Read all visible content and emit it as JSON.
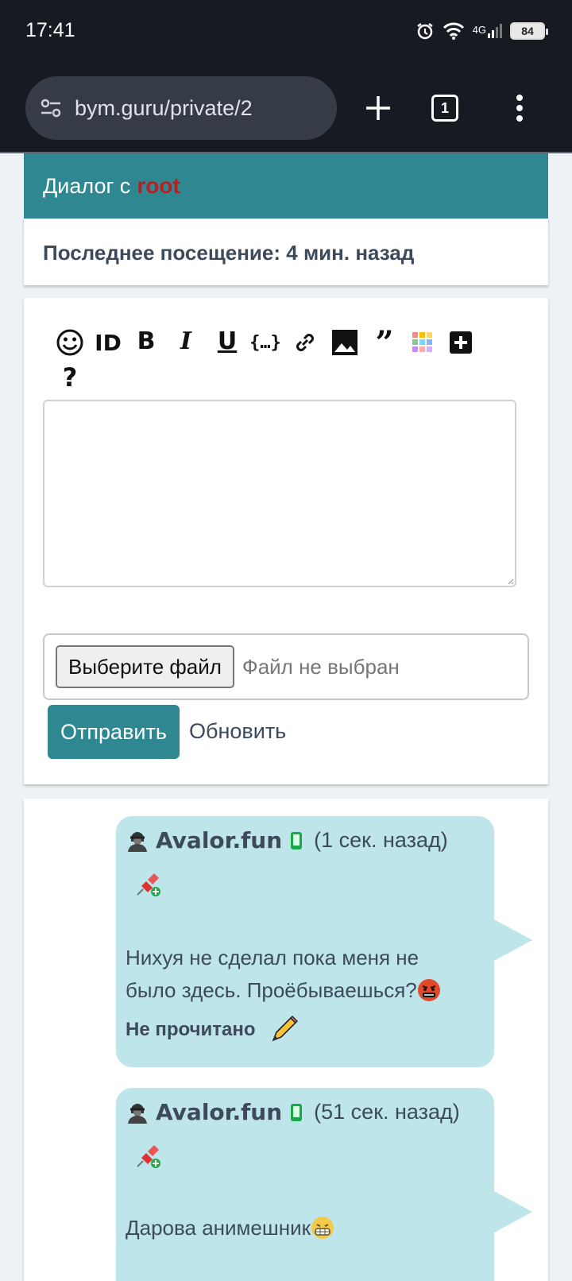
{
  "status": {
    "time": "17:41",
    "network": "4G",
    "battery": "84"
  },
  "browser": {
    "url": "bym.guru/private/2",
    "tabs": "1"
  },
  "dialog": {
    "title": "Диалог с",
    "username": "root",
    "last_seen": "Последнее посещение: 4 мин. назад"
  },
  "composer": {
    "toolbar": [
      "smile-icon",
      "id-icon",
      "bold-icon",
      "italic-icon",
      "underline-icon",
      "code-icon",
      "link-icon",
      "image-icon",
      "quote-icon",
      "color-icon",
      "plus-icon",
      "help-icon"
    ],
    "textarea_value": "",
    "file_button": "Выберите файл",
    "file_status": "Файл не выбран",
    "send_label": "Отправить",
    "refresh_label": "Обновить"
  },
  "messages": [
    {
      "author": "Avalor.fun",
      "time": "(1 сек. назад)",
      "text_line1": "Нихуя не сделал пока меня не",
      "text_line2": "было здесь. Проёбываешься?",
      "status": "Не прочитано"
    },
    {
      "author": "Avalor.fun",
      "time": "(51 сек. назад)",
      "text_line1": "Дарова анимешник"
    }
  ],
  "colors": {
    "accent": "#2f8891",
    "username": "#b32222",
    "bubble": "#bde5ea",
    "text": "#3d4a5c"
  }
}
